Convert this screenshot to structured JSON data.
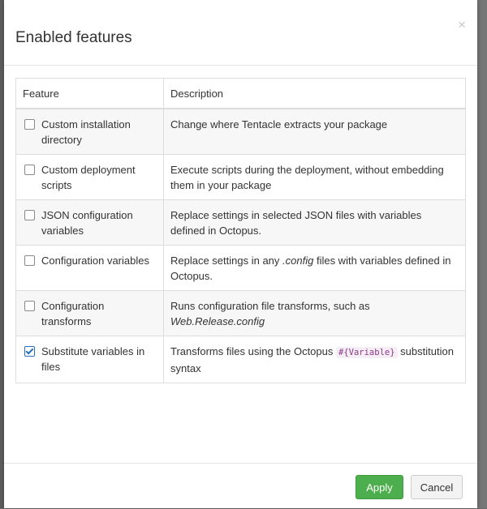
{
  "modal": {
    "title": "Enabled features",
    "close_icon": "×"
  },
  "table": {
    "headers": [
      "Feature",
      "Description"
    ],
    "rows": [
      {
        "feature": "Custom installation directory",
        "checked": false,
        "desc_pre": "Change where Tentacle extracts your package",
        "desc_em": "",
        "desc_post": "",
        "desc_code": ""
      },
      {
        "feature": "Custom deployment scripts",
        "checked": false,
        "desc_pre": "Execute scripts during the deployment, without embedding them in your package",
        "desc_em": "",
        "desc_post": "",
        "desc_code": ""
      },
      {
        "feature": "JSON configuration variables",
        "checked": false,
        "desc_pre": "Replace settings in selected JSON files with variables defined in Octopus.",
        "desc_em": "",
        "desc_post": "",
        "desc_code": ""
      },
      {
        "feature": "Configuration variables",
        "checked": false,
        "desc_pre": "Replace settings in any ",
        "desc_em": ".config",
        "desc_post": " files with variables defined in Octopus.",
        "desc_code": ""
      },
      {
        "feature": "Configuration transforms",
        "checked": false,
        "desc_pre": "Runs configuration file transforms, such as ",
        "desc_em": "Web.Release.config",
        "desc_post": "",
        "desc_code": ""
      },
      {
        "feature": "Substitute variables in files",
        "checked": true,
        "desc_pre": "Transforms files using the Octopus ",
        "desc_em": "",
        "desc_code": "#{Variable}",
        "desc_post": " substitution syntax"
      }
    ]
  },
  "footer": {
    "apply_label": "Apply",
    "cancel_label": "Cancel"
  },
  "colors": {
    "apply": "#4cae4c",
    "checked_box": "#2b6dbf",
    "code_text": "#8b3a8b"
  }
}
